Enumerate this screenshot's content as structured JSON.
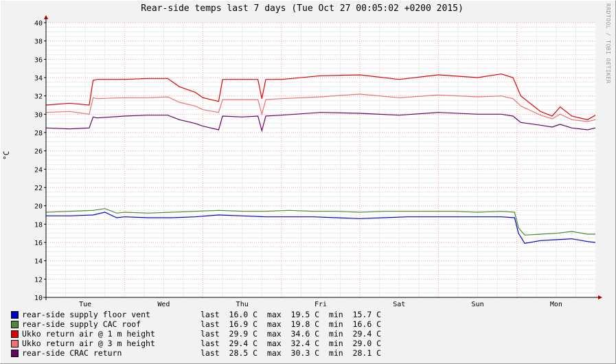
{
  "chart_data": {
    "type": "line",
    "title": "Rear-side temps last 7 days (Tue Oct 27 00:05:02 +0200 2015)",
    "ylabel": "°C",
    "watermark": "RRDTOOL / TOBI OETIKER",
    "ylim": [
      10,
      40
    ],
    "yticks": [
      "10",
      "12",
      "14",
      "16",
      "18",
      "20",
      "22",
      "24",
      "26",
      "28",
      "30",
      "32",
      "34",
      "36",
      "38",
      "40"
    ],
    "xlim": [
      0,
      7
    ],
    "xticks": [
      {
        "label": "Tue",
        "x": 0.5
      },
      {
        "label": "Wed",
        "x": 1.5
      },
      {
        "label": "Thu",
        "x": 2.5
      },
      {
        "label": "Fri",
        "x": 3.5
      },
      {
        "label": "Sat",
        "x": 4.5
      },
      {
        "label": "Sun",
        "x": 5.5
      },
      {
        "label": "Mon",
        "x": 6.5
      }
    ],
    "midnights": [
      1,
      2,
      3,
      4,
      5,
      6
    ],
    "grid": true,
    "legend_position": "bottom",
    "series": [
      {
        "name": "rear-side supply floor vent",
        "color": "#0000cc",
        "last": "16.0 C",
        "max": "19.5 C",
        "min": "15.7 C",
        "x": [
          0,
          0.3,
          0.6,
          0.75,
          0.9,
          1.0,
          1.3,
          1.6,
          1.9,
          2.2,
          2.5,
          2.8,
          3.1,
          3.4,
          3.7,
          4.0,
          4.3,
          4.6,
          4.9,
          5.2,
          5.5,
          5.8,
          5.97,
          6.02,
          6.1,
          6.3,
          6.5,
          6.7,
          6.9,
          7.0
        ],
        "y": [
          18.9,
          18.9,
          19.0,
          19.3,
          18.7,
          18.8,
          18.7,
          18.7,
          18.8,
          19.0,
          18.9,
          18.8,
          18.8,
          18.8,
          18.7,
          18.6,
          18.7,
          18.8,
          18.8,
          18.8,
          18.8,
          18.8,
          18.7,
          17.0,
          15.9,
          16.2,
          16.3,
          16.4,
          16.1,
          16.0
        ]
      },
      {
        "name": "rear-side supply CAC roof",
        "color": "#4a8a3a",
        "last": "16.9 C",
        "max": "19.8 C",
        "min": "16.6 C",
        "x": [
          0,
          0.3,
          0.6,
          0.75,
          0.9,
          1.0,
          1.3,
          1.6,
          1.9,
          2.2,
          2.5,
          2.8,
          3.1,
          3.4,
          3.7,
          4.0,
          4.3,
          4.6,
          4.9,
          5.2,
          5.5,
          5.8,
          5.97,
          6.02,
          6.1,
          6.3,
          6.5,
          6.7,
          6.9,
          7.0
        ],
        "y": [
          19.3,
          19.4,
          19.5,
          19.7,
          19.2,
          19.3,
          19.2,
          19.3,
          19.4,
          19.5,
          19.4,
          19.4,
          19.5,
          19.4,
          19.4,
          19.3,
          19.4,
          19.4,
          19.4,
          19.4,
          19.3,
          19.4,
          19.3,
          17.6,
          16.8,
          16.9,
          17.0,
          17.2,
          16.9,
          16.9
        ]
      },
      {
        "name": "Ukko return air @ 1 m height",
        "color": "#e00000",
        "last": "29.9 C",
        "max": "34.6 C",
        "min": "29.4 C",
        "x": [
          0,
          0.3,
          0.55,
          0.6,
          0.65,
          1.0,
          1.3,
          1.55,
          1.7,
          1.9,
          2.0,
          2.2,
          2.25,
          2.5,
          2.7,
          2.75,
          2.8,
          3.0,
          3.5,
          4.0,
          4.5,
          5.0,
          5.5,
          5.8,
          5.95,
          6.05,
          6.3,
          6.45,
          6.55,
          6.7,
          6.9,
          7.0
        ],
        "y": [
          31.0,
          31.2,
          31.0,
          33.7,
          33.8,
          33.8,
          33.9,
          33.9,
          33.0,
          32.4,
          31.8,
          31.4,
          33.8,
          33.8,
          33.8,
          31.7,
          33.8,
          33.8,
          34.2,
          34.3,
          33.8,
          34.3,
          34.0,
          34.4,
          34.0,
          32.0,
          30.3,
          29.8,
          30.8,
          29.8,
          29.4,
          29.9
        ]
      },
      {
        "name": "Ukko return air @ 3 m height",
        "color": "#f07070",
        "last": "29.4 C",
        "max": "32.4 C",
        "min": "29.0 C",
        "x": [
          0,
          0.3,
          0.55,
          0.6,
          0.65,
          1.0,
          1.3,
          1.55,
          1.7,
          1.9,
          2.0,
          2.2,
          2.25,
          2.5,
          2.7,
          2.75,
          2.8,
          3.0,
          3.5,
          4.0,
          4.5,
          5.0,
          5.5,
          5.8,
          5.95,
          6.05,
          6.3,
          6.45,
          6.55,
          6.7,
          6.9,
          7.0
        ],
        "y": [
          30.2,
          30.3,
          30.0,
          31.8,
          31.7,
          31.8,
          31.8,
          31.9,
          31.3,
          30.9,
          30.5,
          30.2,
          31.6,
          31.6,
          31.6,
          30.0,
          31.6,
          31.7,
          31.9,
          32.2,
          31.8,
          32.1,
          31.9,
          32.0,
          31.7,
          30.9,
          29.9,
          29.5,
          30.0,
          29.4,
          29.2,
          29.4
        ]
      },
      {
        "name": "rear-side CRAC return",
        "color": "#660066",
        "last": "28.5 C",
        "max": "30.3 C",
        "min": "28.1 C",
        "x": [
          0,
          0.3,
          0.55,
          0.6,
          0.65,
          1.0,
          1.3,
          1.55,
          1.7,
          1.9,
          2.0,
          2.2,
          2.25,
          2.5,
          2.7,
          2.75,
          2.8,
          3.0,
          3.5,
          4.0,
          4.5,
          5.0,
          5.5,
          5.8,
          5.95,
          6.05,
          6.3,
          6.45,
          6.55,
          6.7,
          6.9,
          7.0
        ],
        "y": [
          28.5,
          28.4,
          28.5,
          29.7,
          29.6,
          29.8,
          29.9,
          29.9,
          29.4,
          29.0,
          28.7,
          28.3,
          29.8,
          29.7,
          29.8,
          28.2,
          29.8,
          29.9,
          30.2,
          30.1,
          29.9,
          30.2,
          30.0,
          30.0,
          29.8,
          29.1,
          28.8,
          28.6,
          28.9,
          28.5,
          28.3,
          28.5
        ]
      }
    ]
  },
  "legend": {
    "last_label": "last",
    "max_label": "max",
    "min_label": "min"
  }
}
